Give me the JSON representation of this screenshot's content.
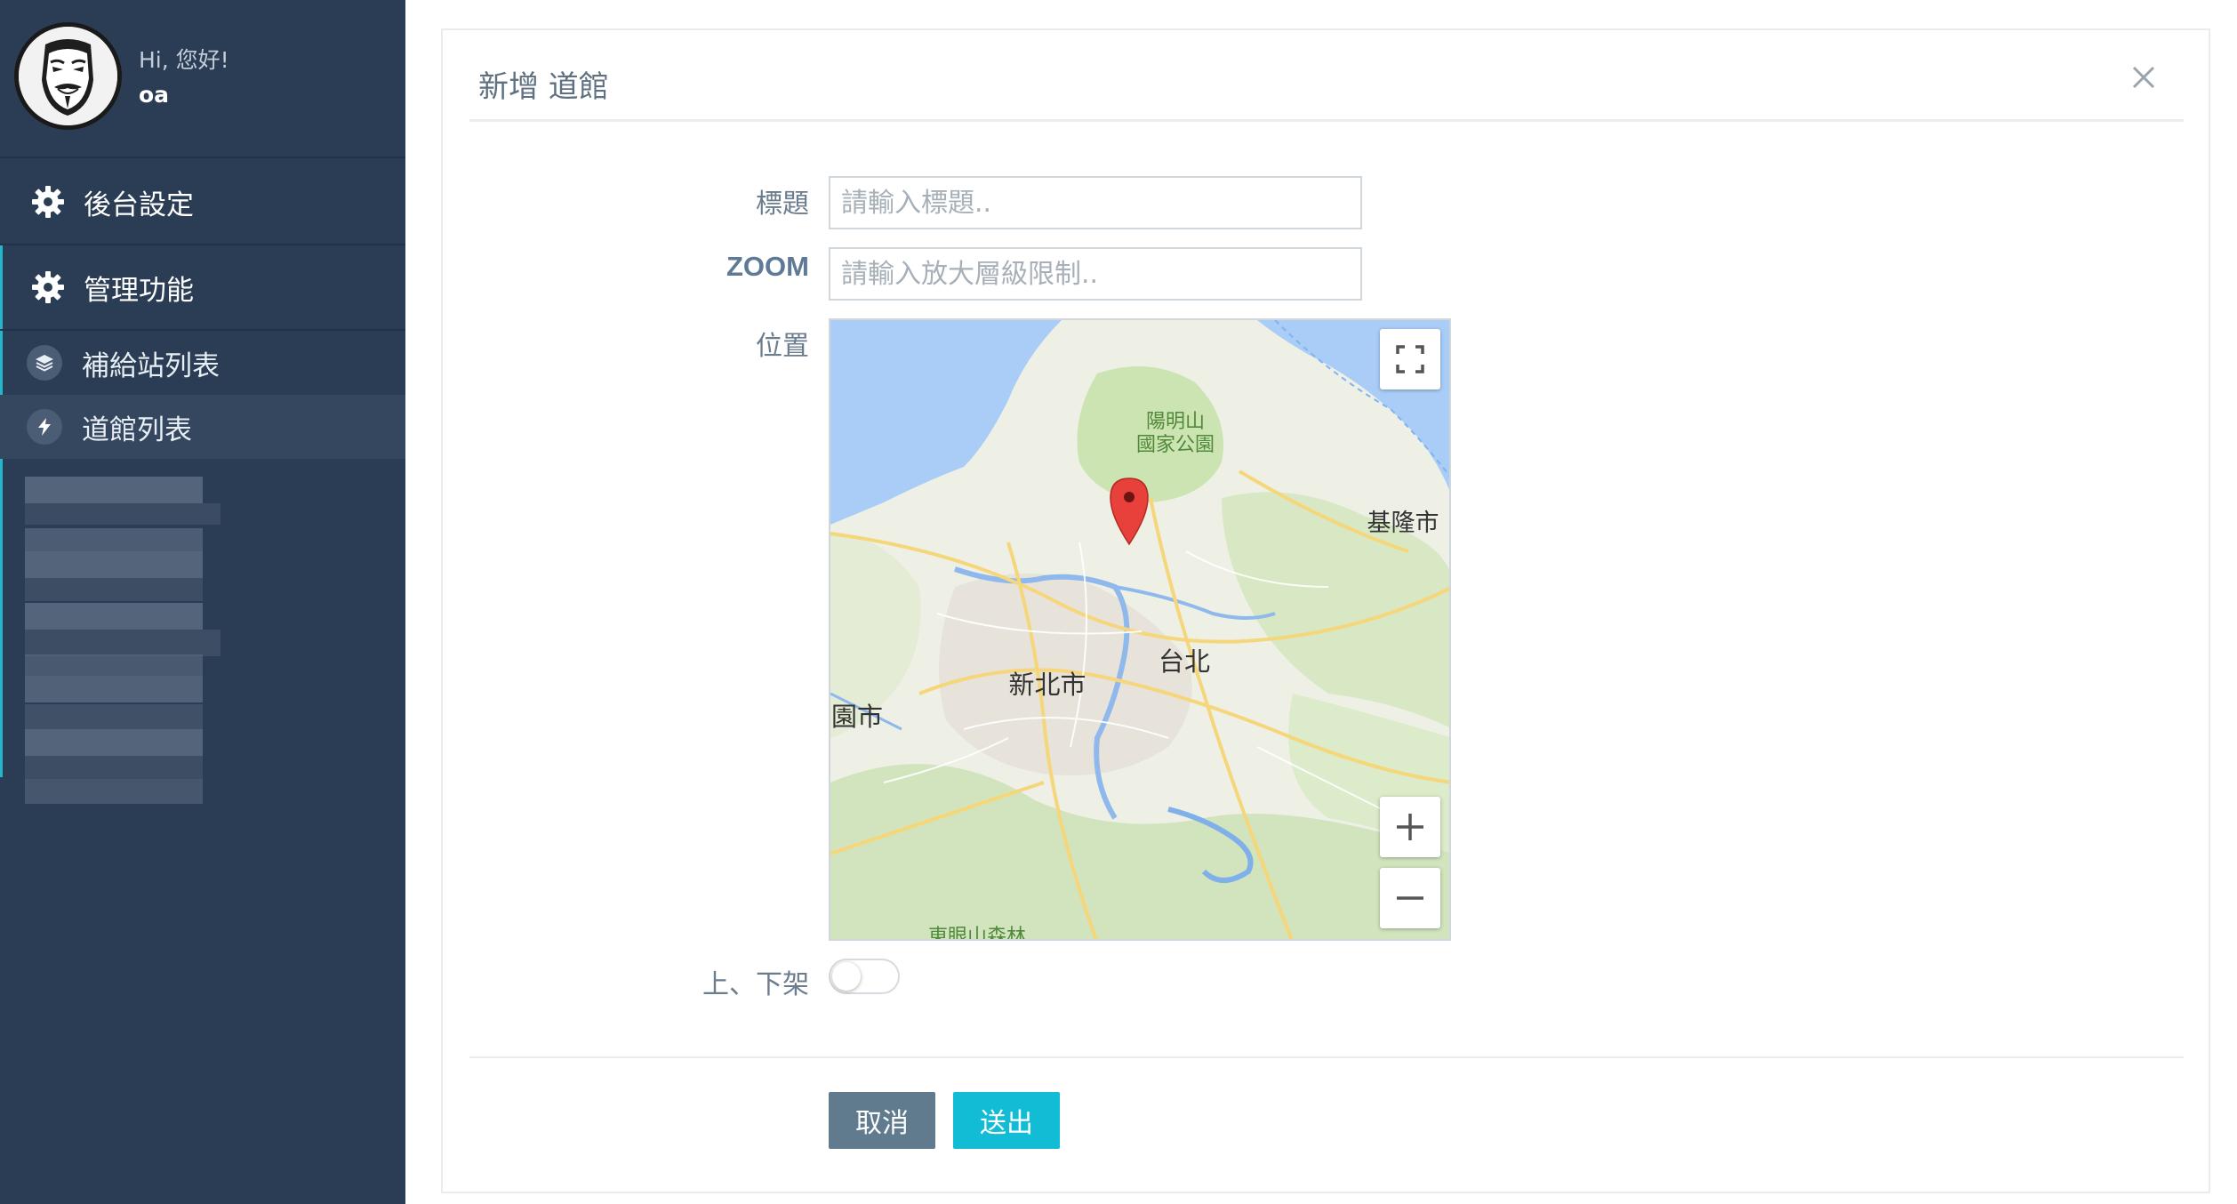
{
  "sidebar": {
    "greeting": "Hi, 您好!",
    "username": "oa",
    "menu": [
      {
        "label": "後台設定",
        "icon": "gear-icon"
      },
      {
        "label": "管理功能",
        "icon": "gear-icon"
      }
    ],
    "subitems": [
      {
        "label": "補給站列表",
        "icon": "layers-icon"
      },
      {
        "label": "道館列表",
        "icon": "lightning-icon",
        "active": true
      }
    ],
    "colors": {
      "background": "#2b3d54",
      "accent": "#23b7c9"
    }
  },
  "modal": {
    "title": "新增 道館",
    "fields": {
      "title_label": "標題",
      "title_placeholder": "請輸入標題..",
      "zoom_label": "ZOOM",
      "zoom_placeholder": "請輸入放大層級限制..",
      "position_label": "位置",
      "toggle_label": "上、下架"
    },
    "buttons": {
      "cancel": "取消",
      "submit": "送出"
    },
    "colors": {
      "cancel": "#607b8d",
      "submit": "#11bcd4"
    }
  },
  "map": {
    "labels": {
      "park": "陽明山\n國家公園",
      "keelung": "基隆市",
      "taipei": "台北",
      "new_taipei": "新北市",
      "taoyuan": "園市",
      "forest": "東眼山森林"
    },
    "controls": {
      "fullscreen": "fullscreen-icon",
      "zoom_in": "plus-icon",
      "zoom_out": "minus-icon"
    },
    "marker": "map-pin-icon"
  }
}
